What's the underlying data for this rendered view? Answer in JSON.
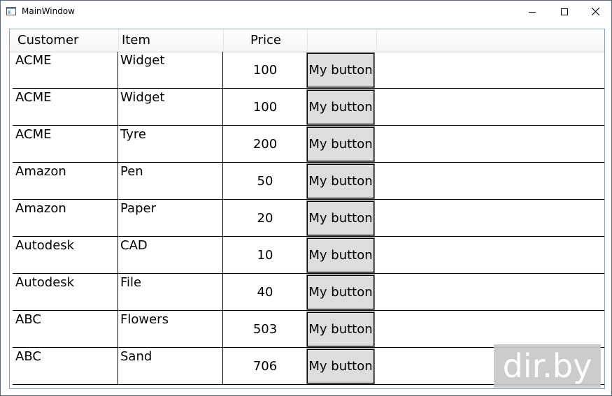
{
  "window": {
    "title": "MainWindow"
  },
  "titlebar_icons": {
    "minimize": "minimize-icon",
    "maximize": "maximize-icon",
    "close": "close-icon",
    "app": "app-window-icon"
  },
  "grid": {
    "columns": [
      "Customer",
      "Item",
      "Price",
      ""
    ],
    "rows": [
      {
        "customer": "ACME",
        "item": "Widget",
        "price": "100",
        "button": "My button"
      },
      {
        "customer": "ACME",
        "item": "Widget",
        "price": "100",
        "button": "My button"
      },
      {
        "customer": "ACME",
        "item": "Tyre",
        "price": "200",
        "button": "My button"
      },
      {
        "customer": "Amazon",
        "item": "Pen",
        "price": "50",
        "button": "My button"
      },
      {
        "customer": "Amazon",
        "item": "Paper",
        "price": "20",
        "button": "My button"
      },
      {
        "customer": "Autodesk",
        "item": "CAD",
        "price": "10",
        "button": "My button"
      },
      {
        "customer": "Autodesk",
        "item": "File",
        "price": "40",
        "button": "My button"
      },
      {
        "customer": "ABC",
        "item": "Flowers",
        "price": "503",
        "button": "My button"
      },
      {
        "customer": "ABC",
        "item": "Sand",
        "price": "706",
        "button": "My button"
      }
    ]
  },
  "watermark": {
    "text": "dir.by"
  },
  "colors": {
    "grid_border": "#8aa4c0",
    "button_face": "#dddddd",
    "row_line": "#000000"
  }
}
